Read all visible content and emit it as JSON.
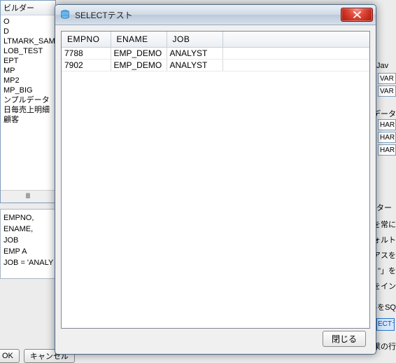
{
  "background": {
    "tree_header": "ビルダー",
    "tree_items": [
      "O",
      "D",
      "LTMARK_SAM",
      "LOB_TEST",
      "EPT",
      "MP",
      "MP2",
      "MP_BIG",
      "ンプルデータ",
      "日毎売上明細",
      "顧客"
    ],
    "tree_scroll_hint": "Ⅲ",
    "sql_lines": [
      "EMPNO,",
      "ENAME,",
      "JOB",
      "EMP A",
      "JOB = 'ANALY"
    ],
    "buttons": {
      "ok": "OK",
      "cancel": "キャンセル"
    },
    "right_fragments": {
      "jav_label": "Jav",
      "t1": "VAR",
      "t2": "VAR",
      "data_label": "データ",
      "d1": "HAR",
      "d2": "HAR",
      "d3": "HAR",
      "filter_label": "ター",
      "opts": [
        "を常に",
        "ォルト",
        "リアスを",
        "を「\" 」",
        "をイン",
        "ルをSQ"
      ],
      "select_btn": "ECTテ",
      "result_label": "果の行"
    }
  },
  "dialog": {
    "title": "SELECTテスト",
    "columns": [
      "EMPNO",
      "ENAME",
      "JOB"
    ],
    "rows": [
      {
        "EMPNO": "7788",
        "ENAME": "EMP_DEMO",
        "JOB": "ANALYST"
      },
      {
        "EMPNO": "7902",
        "ENAME": "EMP_DEMO",
        "JOB": "ANALYST"
      }
    ],
    "close_label": "閉じる"
  }
}
